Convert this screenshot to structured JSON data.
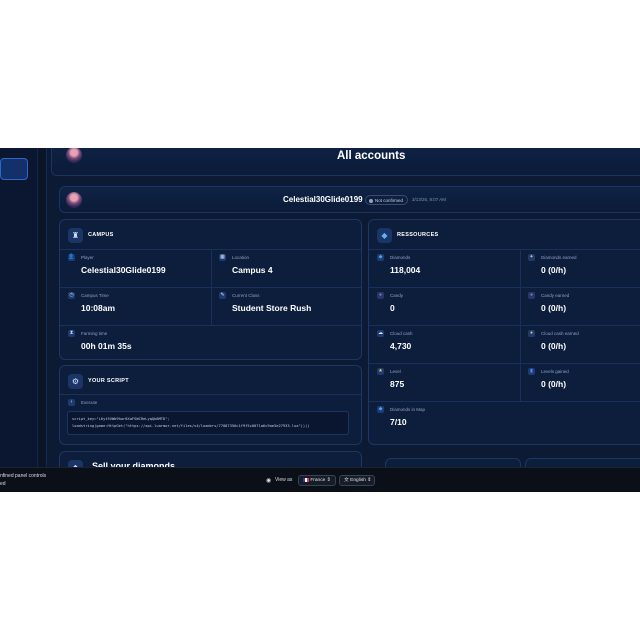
{
  "page": {
    "title": "All accounts"
  },
  "account": {
    "name": "Celestial30Glide0199",
    "status": "Not confirmed",
    "timestamp": "3/13/26, 8:07 AM"
  },
  "campus": {
    "title": "CAMPUS",
    "player_label": "Player",
    "player_value": "Celestial30Glide0199",
    "location_label": "Location",
    "location_value": "Campus 4",
    "time_label": "Campus Time",
    "time_value": "10:08am",
    "class_label": "Current Class",
    "class_value": "Student Store Rush",
    "farming_label": "Farming time",
    "farming_value": "00h 01m 35s"
  },
  "resources": {
    "title": "RESSOURCES",
    "items": [
      {
        "label": "Diamonds",
        "value": "118,004",
        "icon": "diamond-icon",
        "color": "#4aa3ff"
      },
      {
        "label": "Diamonds earned",
        "value": "0 (0/h)",
        "icon": "sparkle-icon",
        "color": "#f2c94c"
      },
      {
        "label": "Candy",
        "value": "0",
        "icon": "candy-icon",
        "color": "#e0566b"
      },
      {
        "label": "Candy earned",
        "value": "0 (0/h)",
        "icon": "candy-icon",
        "color": "#e0566b"
      },
      {
        "label": "Cloud cash",
        "value": "4,730",
        "icon": "cloud-icon",
        "color": "#dfe8f5"
      },
      {
        "label": "Cloud cash earned",
        "value": "0 (0/h)",
        "icon": "coin-icon",
        "color": "#f2b84c"
      },
      {
        "label": "Level",
        "value": "875",
        "icon": "star-icon",
        "color": "#f2c94c"
      },
      {
        "label": "Levels gained",
        "value": "0 (0/h)",
        "icon": "levels-icon",
        "color": "#4a8cff"
      },
      {
        "label": "Diamonds in Map",
        "value": "7/10",
        "icon": "map-diamond-icon",
        "color": "#4aa3ff"
      }
    ]
  },
  "script": {
    "title": "YOUR SCRIPT",
    "execute_label": "Execute",
    "code_line1": "script_key=\"L6yt5VWb9hwr8XaFSWCReLyqQb8MTD\";",
    "code_line2": "loadstring(game:HttpGet(\"https://api.luarmor.net/files/v4/loaders/77087356c1f9f5c0071a6c9ae5e27933.lua\"))()"
  },
  "sell": {
    "title": "Sell your diamonds"
  },
  "bottom_bar": {
    "left_line1": "nfined panel controls",
    "left_line2": "ed",
    "view_as_label": "View as",
    "country": "France",
    "language": "English"
  }
}
